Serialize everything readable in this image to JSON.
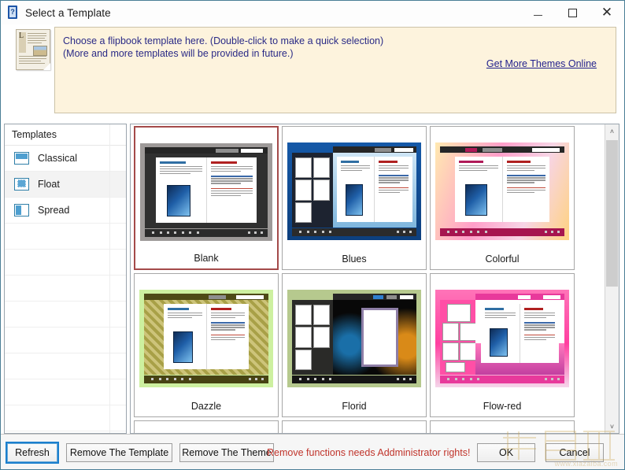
{
  "window": {
    "title": "Select a Template",
    "icon": "help-book-icon",
    "minimize_label": "–",
    "maximize_label": "□",
    "close_label": "✕"
  },
  "header": {
    "icon": "document-page-icon",
    "line1": "Choose a flipbook template here. (Double-click to make a quick selection)",
    "line2": "(More and more templates will be provided in future.)",
    "link": "Get More Themes Online",
    "panel_color": "#fdf3dd",
    "text_color": "#2a2a86"
  },
  "sidebar": {
    "header": "Templates",
    "items": [
      {
        "label": "Classical",
        "icon": "classical-layout-icon",
        "selected": false
      },
      {
        "label": "Float",
        "icon": "float-layout-icon",
        "selected": true
      },
      {
        "label": "Spread",
        "icon": "spread-layout-icon",
        "selected": false
      }
    ],
    "empty_rows": 9
  },
  "grid": {
    "selected": "Blank",
    "selected_border_color": "#a44a4a",
    "rows": [
      [
        {
          "name": "Blank",
          "style": "blank",
          "selected": true
        },
        {
          "name": "Blues",
          "style": "blues",
          "selected": false
        },
        {
          "name": "Colorful",
          "style": "colorful",
          "selected": false
        }
      ],
      [
        {
          "name": "Dazzle",
          "style": "dazzle",
          "selected": false
        },
        {
          "name": "Florid",
          "style": "florid",
          "selected": false
        },
        {
          "name": "Flow-red",
          "style": "flowred",
          "selected": false
        }
      ]
    ],
    "partial_row_count": 3,
    "thumb_page_titles": [
      "What is Flip PDF",
      "Why Choose Flip PDF?"
    ]
  },
  "scrollbar": {
    "up_arrow": "˄",
    "down_arrow": "˅",
    "thumb_top_pct": 5,
    "thumb_height_pct": 48
  },
  "footer": {
    "refresh": "Refresh",
    "remove_template": "Remove The Template",
    "remove_theme": "Remove The Theme",
    "warning": "Remove functions needs Addministrator rights!",
    "warning_color": "#c0342b",
    "ok": "OK",
    "cancel": "Cancel"
  },
  "watermark": {
    "text": "www.xiazaiba.com"
  }
}
